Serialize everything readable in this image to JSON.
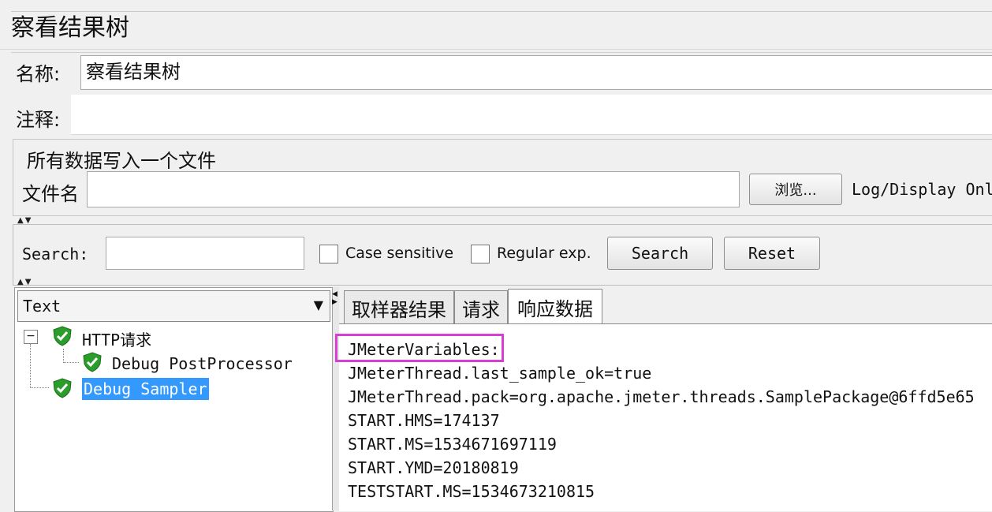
{
  "title": "察看结果树",
  "name_label": "名称:",
  "name_value": "察看结果树",
  "comment_label": "注释:",
  "comment_value": "",
  "file_group": {
    "title": "所有数据写入一个文件",
    "filename_label": "文件名",
    "filename_value": "",
    "browse_label": "浏览...",
    "log_display_label": "Log/Display Onl"
  },
  "search": {
    "label": "Search:",
    "value": "",
    "case_sensitive_label": "Case sensitive",
    "regex_label": "Regular exp.",
    "search_button": "Search",
    "reset_button": "Reset"
  },
  "renderer": {
    "selected": "Text"
  },
  "tree": {
    "root": "HTTP请求",
    "child": "Debug PostProcessor",
    "sampler": "Debug Sampler"
  },
  "tabs": [
    "取样器结果",
    "请求",
    "响应数据"
  ],
  "active_tab": "响应数据",
  "response_lines": [
    "JMeterVariables:",
    "JMeterThread.last_sample_ok=true",
    "JMeterThread.pack=org.apache.jmeter.threads.SamplePackage@6ffd5e65",
    "START.HMS=174137",
    "START.MS=1534671697119",
    "START.YMD=20180819",
    "TESTSTART.MS=1534673210815"
  ],
  "colors": {
    "highlight_box": "#d63fd2",
    "selection": "#3399ff",
    "shield": "#2a9d2a"
  }
}
